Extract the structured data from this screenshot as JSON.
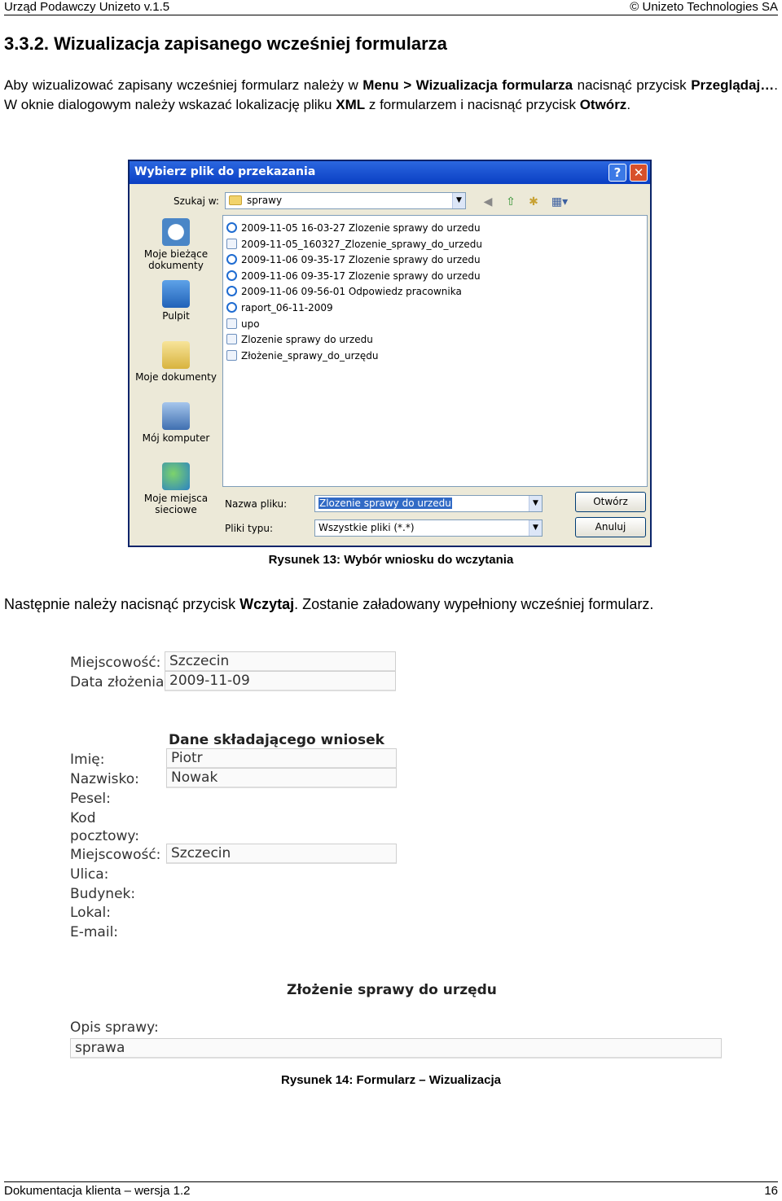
{
  "header": {
    "left": "Urząd  Podawczy Unizeto  v.1.5",
    "right": "© Unizeto Technologies SA"
  },
  "section_title": "3.3.2.  Wizualizacja zapisanego wcześniej formularza",
  "intro": {
    "t1": "Aby wizualizować zapisany wcześniej formularz należy w ",
    "b1": "Menu > Wizualizacja formularza",
    "t2": "  nacisnąć przycisk ",
    "b2": "Przeglądaj…",
    "t3": ". W oknie dialogowym należy wskazać lokalizację pliku ",
    "b3": "XML",
    "t4": " z formularzem i nacisnąć przycisk ",
    "b4": "Otwórz",
    "t5": "."
  },
  "dialog": {
    "title": "Wybierz plik do przekazania",
    "help_icon": "?",
    "close_icon": "✕",
    "look_in_label": "Szukaj w:",
    "look_in_value": "sprawy",
    "toolbar_icons": [
      "back-icon",
      "up-folder-icon",
      "new-folder-icon",
      "view-menu-icon"
    ],
    "places": [
      {
        "label1": "Moje bieżące",
        "label2": "dokumenty",
        "icon": "recent-documents-icon"
      },
      {
        "label1": "Pulpit",
        "label2": "",
        "icon": "desktop-icon"
      },
      {
        "label1": "Moje dokumenty",
        "label2": "",
        "icon": "my-documents-icon"
      },
      {
        "label1": "Mój komputer",
        "label2": "",
        "icon": "my-computer-icon"
      },
      {
        "label1": "Moje miejsca",
        "label2": "sieciowe",
        "icon": "network-places-icon"
      }
    ],
    "files": [
      {
        "name": "2009-11-05 16-03-27 Zlozenie sprawy do urzedu",
        "icon": "ie-file-icon"
      },
      {
        "name": "2009-11-05_160327_Zlozenie_sprawy_do_urzedu",
        "icon": "file-icon"
      },
      {
        "name": "2009-11-06 09-35-17 Zlozenie sprawy do urzedu",
        "icon": "ie-file-icon"
      },
      {
        "name": "2009-11-06 09-35-17 Zlozenie sprawy do urzedu",
        "icon": "ie-file-icon"
      },
      {
        "name": "2009-11-06 09-56-01 Odpowiedz pracownika",
        "icon": "ie-file-icon"
      },
      {
        "name": "raport_06-11-2009",
        "icon": "ie-file-icon"
      },
      {
        "name": "upo",
        "icon": "xml-file-icon"
      },
      {
        "name": "Zlozenie sprawy do urzedu",
        "icon": "xml-file-icon"
      },
      {
        "name": "Złożenie_sprawy_do_urzędu",
        "icon": "xml-file-icon"
      }
    ],
    "file_name_label": "Nazwa pliku:",
    "file_name_value": "Zlozenie sprawy do urzedu",
    "file_type_label": "Pliki typu:",
    "file_type_value": "Wszystkie pliki (*.*)",
    "open_button": "Otwórz",
    "cancel_button": "Anuluj"
  },
  "caption13": "Rysunek 13: Wybór wniosku do wczytania",
  "para2": {
    "t1": "Następnie należy nacisnąć przycisk ",
    "b1": "Wczytaj",
    "t2": ". Zostanie załadowany wypełniony wcześniej formularz."
  },
  "form": {
    "miejscowosc_label": "Miejscowość:",
    "miejscowosc_value": "Szczecin",
    "data_label": "Data złożenia:",
    "data_value": "2009-11-09",
    "section1": "Dane składającego wniosek",
    "imie_label": "Imię:",
    "imie_value": "Piotr",
    "nazwisko_label": "Nazwisko:",
    "nazwisko_value": "Nowak",
    "pesel_label": "Pesel:",
    "kod_label1": "Kod",
    "kod_label2": "pocztowy:",
    "miejscowosc2_label": "Miejscowość:",
    "miejscowosc2_value": "Szczecin",
    "ulica_label": "Ulica:",
    "budynek_label": "Budynek:",
    "lokal_label": "Lokal:",
    "email_label": "E-mail:",
    "section2": "Złożenie sprawy do urzędu",
    "opis_label": "Opis sprawy:",
    "opis_value": "sprawa"
  },
  "caption14": "Rysunek 14: Formularz – Wizualizacja",
  "footer": {
    "left": "Dokumentacja klienta – wersja 1.2",
    "right": "16"
  }
}
